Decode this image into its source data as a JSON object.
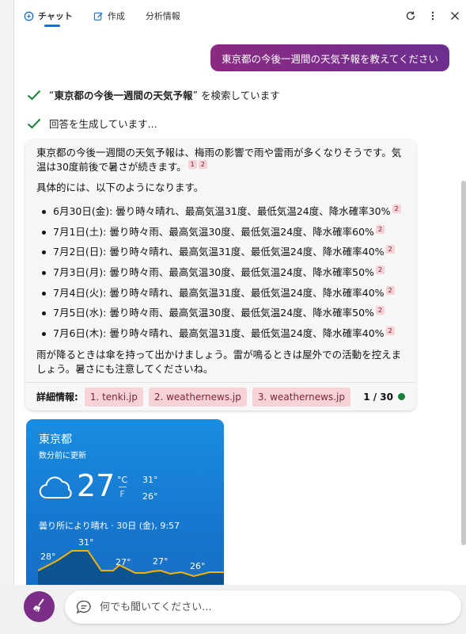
{
  "tabs": [
    {
      "label": "チャット",
      "icon": "chat-icon",
      "active": true
    },
    {
      "label": "作成",
      "icon": "compose-icon",
      "active": false
    },
    {
      "label": "分析情報",
      "icon": "",
      "active": false
    }
  ],
  "header_actions": [
    "refresh-icon",
    "more-icon",
    "close-icon"
  ],
  "user_message": "東京都の今後一週間の天気予報を教えてください",
  "status": {
    "search_quote_open": "“",
    "search_query": "東京都の今後一週間の天気予報",
    "search_quote_close": "”",
    "search_suffix": " を検索しています",
    "generating": "回答を生成しています..."
  },
  "answer": {
    "intro": "東京都の今後一週間の天気予報は、梅雨の影響で雨や雷雨が多くなりそうです。気温は30度前後で暑さが続きます。",
    "intro_cites": [
      "1",
      "2"
    ],
    "lead": "具体的には、以下のようになります。",
    "items": [
      {
        "text": "6月30日(金): 曇り時々晴れ、最高気温31度、最低気温24度、降水確率30%",
        "cite": "2"
      },
      {
        "text": "7月1日(土): 曇り時々雨、最高気温30度、最低気温24度、降水確率60%",
        "cite": "2"
      },
      {
        "text": "7月2日(日): 曇り時々晴れ、最高気温31度、最低気温24度、降水確率40%",
        "cite": "2"
      },
      {
        "text": "7月3日(月): 曇り時々雨、最高気温30度、最低気温24度、降水確率50%",
        "cite": "2"
      },
      {
        "text": "7月4日(火): 曇り時々晴れ、最高気温31度、最低気温24度、降水確率40%",
        "cite": "2"
      },
      {
        "text": "7月5日(水): 曇り時々雨、最高気温30度、最低気温24度、降水確率50%",
        "cite": "2"
      },
      {
        "text": "7月6日(木): 曇り時々晴れ、最高気温31度、最低気温24度、降水確率40%",
        "cite": "2"
      }
    ],
    "closing": "雨が降るときは傘を持って出かけましょう。雷が鳴るときは屋外での活動を控えましょう。暑さにも注意してくださいね。",
    "details_label": "詳細情報:",
    "sources": [
      "1. tenki.jp",
      "2. weathernews.jp",
      "3. weathernews.jp"
    ],
    "page_counter": "1 / 30",
    "status_color": "#188038"
  },
  "weather": {
    "city": "東京都",
    "updated": "数分前に更新",
    "temp": "27",
    "unit_c": "°C",
    "unit_f": "F",
    "high": "31°",
    "low": "26°",
    "condition": "曇り所により晴れ · 30日 (金), 9:57",
    "graph_labels": [
      "28°",
      "31°",
      "27°",
      "27°",
      "26°"
    ],
    "icon": "cloud-icon"
  },
  "input": {
    "placeholder": "何でも聞いてください..."
  },
  "colors": {
    "accent": "#1b6dd6",
    "user_bubble": "#7a2c8a",
    "check": "#188038",
    "citation_bg": "#f7d2d6"
  }
}
